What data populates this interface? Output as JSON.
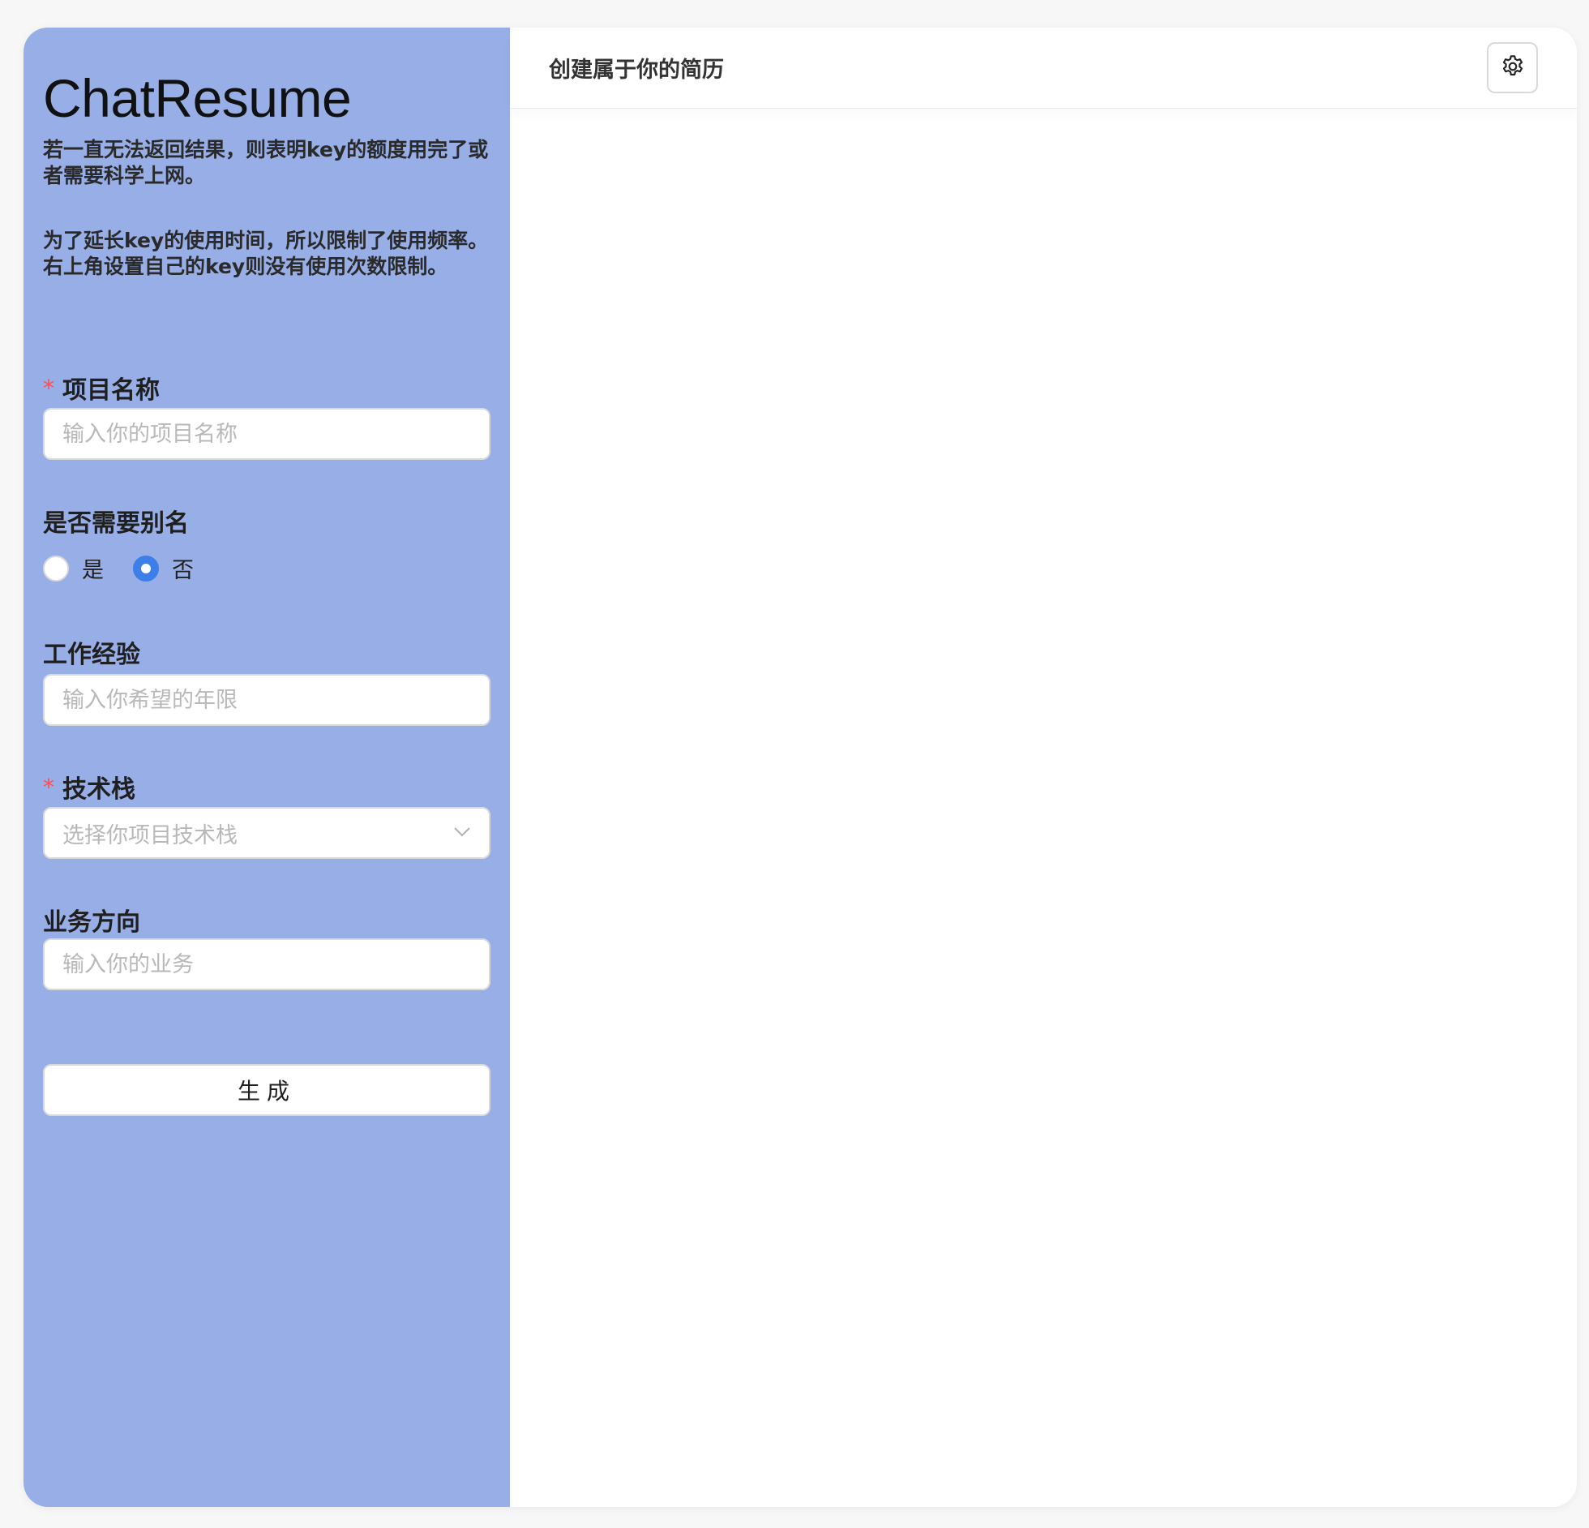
{
  "sidebar": {
    "app_title": "ChatResume",
    "notice_1": "若一直无法返回结果，则表明key的额度用完了或者需要科学上网。",
    "notice_2": "为了延长key的使用时间，所以限制了使用频率。右上角设置自己的key则没有使用次数限制。",
    "required_mark": "*",
    "form": {
      "project_name": {
        "label": "项目名称",
        "required": true,
        "value": "",
        "placeholder": "输入你的项目名称"
      },
      "alias": {
        "label": "是否需要别名",
        "options": [
          "是",
          "否"
        ],
        "selected": "否"
      },
      "experience": {
        "label": "工作经验",
        "value": "",
        "placeholder": "输入你希望的年限"
      },
      "tech_stack": {
        "label": "技术栈",
        "required": true,
        "placeholder": "选择你项目技术栈",
        "icon": "chevron-down-icon"
      },
      "business": {
        "label": "业务方向",
        "value": "",
        "placeholder": "输入你的业务"
      }
    },
    "generate_label": "生成"
  },
  "main": {
    "title": "创建属于你的简历",
    "settings_icon": "gear-icon"
  },
  "colors": {
    "sidebar_bg": "#98aee6",
    "radio_checked": "#3d7fe8",
    "required": "#ff4d4f",
    "placeholder": "#b8b8b8"
  }
}
